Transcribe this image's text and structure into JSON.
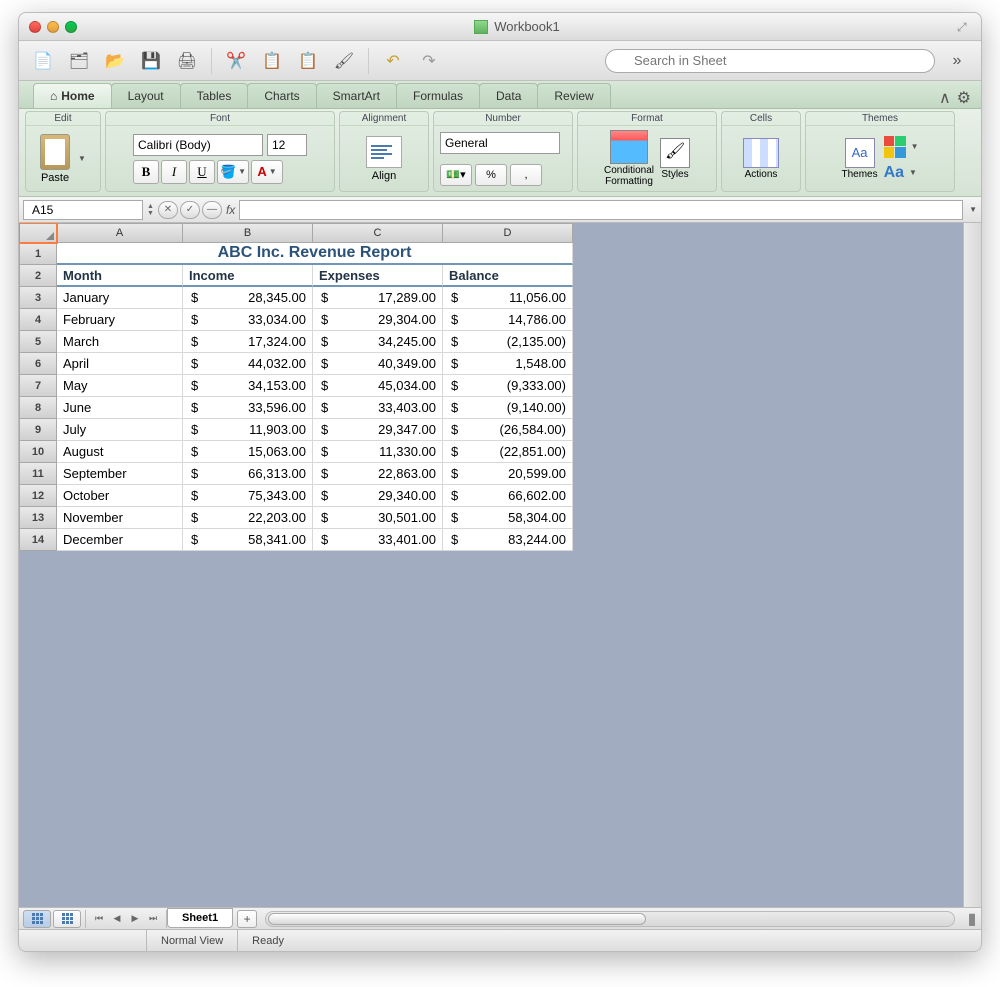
{
  "window": {
    "title": "Workbook1"
  },
  "search": {
    "placeholder": "Search in Sheet"
  },
  "tabs": [
    "Home",
    "Layout",
    "Tables",
    "Charts",
    "SmartArt",
    "Formulas",
    "Data",
    "Review"
  ],
  "ribbon": {
    "edit_label": "Edit",
    "paste_label": "Paste",
    "font_label": "Font",
    "font_name": "Calibri (Body)",
    "font_size": "12",
    "alignment_label": "Alignment",
    "align_label": "Align",
    "number_label": "Number",
    "number_format": "General",
    "format_label": "Format",
    "cond_fmt_label": "Conditional\nFormatting",
    "styles_label": "Styles",
    "cells_label": "Cells",
    "actions_label": "Actions",
    "themes_label": "Themes",
    "themes_btn_label": "Themes",
    "aa_label": "Aa"
  },
  "namebox": "A15",
  "columns": [
    "A",
    "B",
    "C",
    "D"
  ],
  "report_title": "ABC Inc. Revenue Report",
  "headers": {
    "month": "Month",
    "income": "Income",
    "expenses": "Expenses",
    "balance": "Balance"
  },
  "rows": [
    {
      "n": "3",
      "month": "January",
      "income": "28,345.00",
      "expenses": "17,289.00",
      "balance": "11,056.00"
    },
    {
      "n": "4",
      "month": "February",
      "income": "33,034.00",
      "expenses": "29,304.00",
      "balance": "14,786.00"
    },
    {
      "n": "5",
      "month": "March",
      "income": "17,324.00",
      "expenses": "34,245.00",
      "balance": "(2,135.00)"
    },
    {
      "n": "6",
      "month": "April",
      "income": "44,032.00",
      "expenses": "40,349.00",
      "balance": "1,548.00"
    },
    {
      "n": "7",
      "month": "May",
      "income": "34,153.00",
      "expenses": "45,034.00",
      "balance": "(9,333.00)"
    },
    {
      "n": "8",
      "month": "June",
      "income": "33,596.00",
      "expenses": "33,403.00",
      "balance": "(9,140.00)"
    },
    {
      "n": "9",
      "month": "July",
      "income": "11,903.00",
      "expenses": "29,347.00",
      "balance": "(26,584.00)"
    },
    {
      "n": "10",
      "month": "August",
      "income": "15,063.00",
      "expenses": "11,330.00",
      "balance": "(22,851.00)"
    },
    {
      "n": "11",
      "month": "September",
      "income": "66,313.00",
      "expenses": "22,863.00",
      "balance": "20,599.00"
    },
    {
      "n": "12",
      "month": "October",
      "income": "75,343.00",
      "expenses": "29,340.00",
      "balance": "66,602.00"
    },
    {
      "n": "13",
      "month": "November",
      "income": "22,203.00",
      "expenses": "30,501.00",
      "balance": "58,304.00"
    },
    {
      "n": "14",
      "month": "December",
      "income": "58,341.00",
      "expenses": "33,401.00",
      "balance": "83,244.00"
    }
  ],
  "sheet_tab": "Sheet1",
  "status": {
    "view": "Normal View",
    "ready": "Ready"
  },
  "currency": "$"
}
